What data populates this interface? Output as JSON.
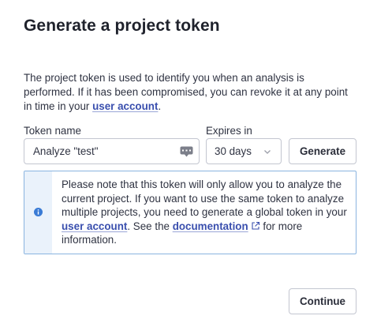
{
  "dialog": {
    "title": "Generate a project token",
    "description_part1": "The project token is used to identify you when an analysis is performed. If it has been compromised, you can revoke it at any point in time in your ",
    "description_link": "user account",
    "description_part2": "."
  },
  "form": {
    "token_name_label": "Token name",
    "token_name_value": "Analyze \"test\"",
    "token_field_icon": "keyboard-icon",
    "expires_label": "Expires in",
    "expires_value": "30 days",
    "generate_label": "Generate"
  },
  "info": {
    "icon": "info-icon",
    "text_part1": "Please note that this token will only allow you to analyze the current project. If you want to use the same token to analyze multiple projects, you need to generate a global token in your ",
    "link1": "user account",
    "text_part2": ". See the ",
    "link2": "documentation",
    "link2_icon": "external-link-icon",
    "text_part3": " for more information."
  },
  "footer": {
    "continue_label": "Continue"
  },
  "colors": {
    "link": "#3a4fae",
    "info_border": "#8ab4e0",
    "info_icon": "#3a7bd5",
    "info_bg": "#eaf2fb"
  }
}
